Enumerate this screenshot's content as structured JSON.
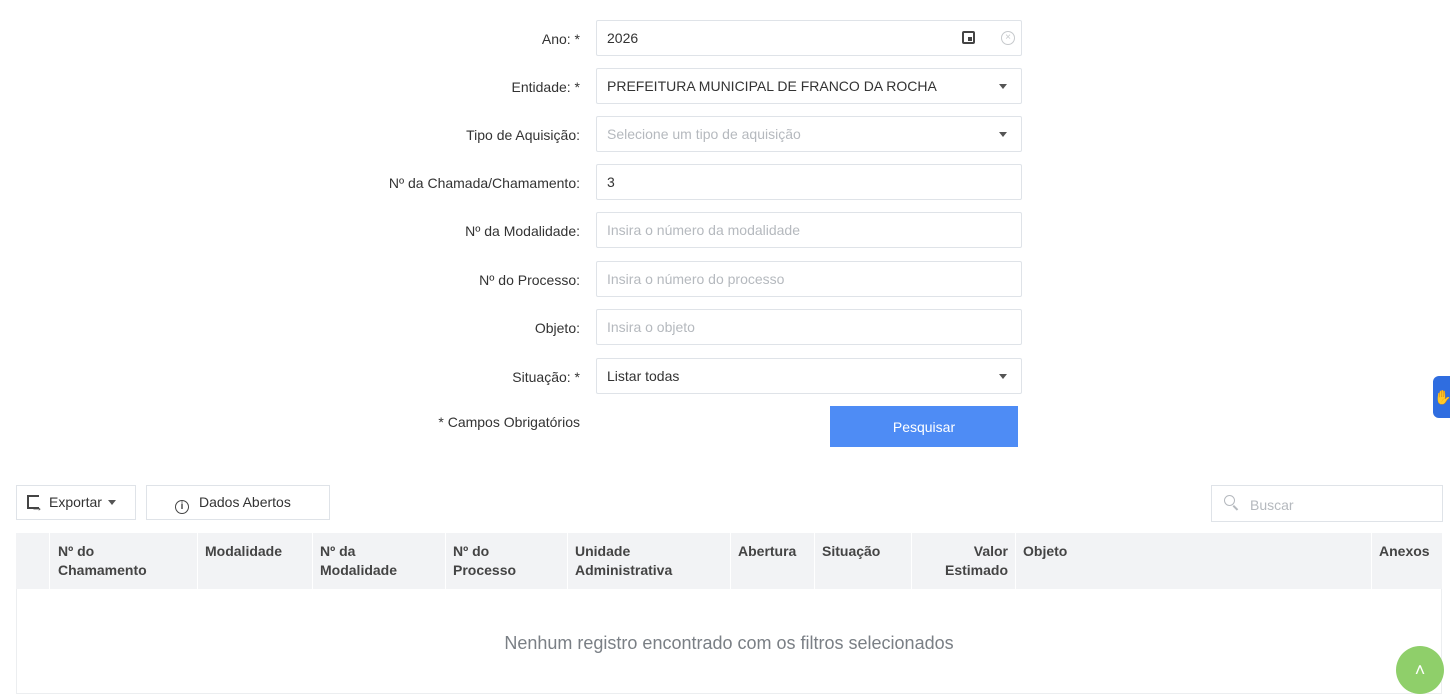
{
  "form": {
    "ano": {
      "label": "Ano: *",
      "value": "2026"
    },
    "entidade": {
      "label": "Entidade: *",
      "value": "PREFEITURA MUNICIPAL DE FRANCO DA ROCHA"
    },
    "tipo_aquisicao": {
      "label": "Tipo de Aquisição:",
      "placeholder": "Selecione um tipo de aquisição"
    },
    "chamada": {
      "label": "Nº da Chamada/Chamamento:",
      "value": "3"
    },
    "modalidade": {
      "label": "Nº da Modalidade:",
      "placeholder": "Insira o número da modalidade"
    },
    "processo": {
      "label": "Nº do Processo:",
      "placeholder": "Insira o número do processo"
    },
    "objeto": {
      "label": "Objeto:",
      "placeholder": "Insira o objeto"
    },
    "situacao": {
      "label": "Situação: *",
      "value": "Listar todas"
    },
    "required_note": "* Campos Obrigatórios",
    "search_button": "Pesquisar"
  },
  "toolbar": {
    "export_label": "Exportar",
    "open_data_label": "Dados Abertos",
    "search_placeholder": "Buscar"
  },
  "table": {
    "columns": [
      {
        "l1": "Nº do",
        "l2": "Chamamento"
      },
      {
        "l1": "Modalidade",
        "l2": ""
      },
      {
        "l1": "Nº da",
        "l2": "Modalidade"
      },
      {
        "l1": "Nº do",
        "l2": "Processo"
      },
      {
        "l1": "Unidade",
        "l2": "Administrativa"
      },
      {
        "l1": "Abertura",
        "l2": ""
      },
      {
        "l1": "Situação",
        "l2": ""
      },
      {
        "l1": "Valor",
        "l2": "Estimado"
      },
      {
        "l1": "Objeto",
        "l2": ""
      },
      {
        "l1": "Anexos",
        "l2": ""
      }
    ],
    "empty_message": "Nenhum registro encontrado com os filtros selecionados"
  },
  "icons": {
    "calendar": "calendar-icon",
    "clear": "clear-icon",
    "dropdown": "chevron-down-icon",
    "export": "export-icon",
    "info": "info-icon",
    "search": "search-icon",
    "accessibility": "hand-icon",
    "scroll_top": "chevron-up-icon"
  },
  "colors": {
    "primary": "#4e8cf5",
    "scroll_top": "#8fcf6a",
    "accessibility": "#2f6de0"
  }
}
